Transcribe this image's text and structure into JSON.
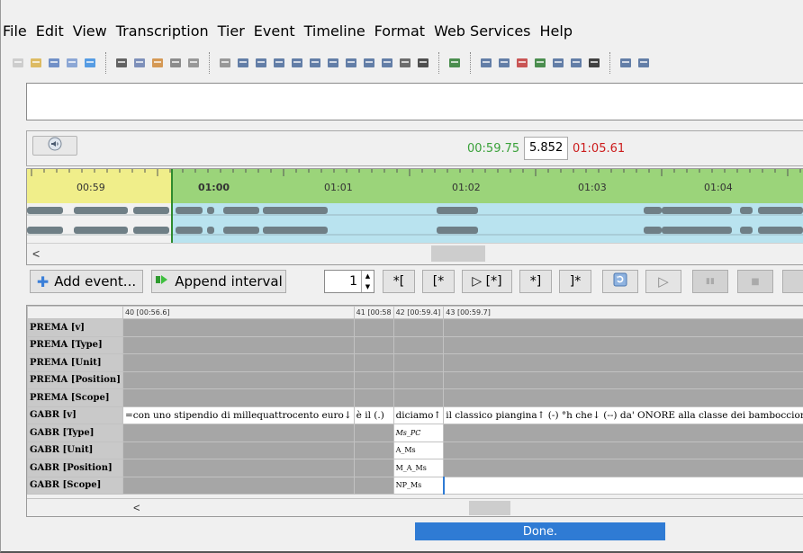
{
  "menu": [
    "File",
    "Edit",
    "View",
    "Transcription",
    "Tier",
    "Event",
    "Timeline",
    "Format",
    "Web Services",
    "Help"
  ],
  "toolbar_icons": [
    "new-file-icon",
    "open-folder-icon",
    "save-icon",
    "print-icon",
    "web-icon",
    "export-icon",
    "globe-icon",
    "people-icon",
    "search-icon",
    "split-text-icon",
    "merge-text-icon",
    "grid-a-icon",
    "grid-b-icon",
    "grid-c-icon",
    "move-left-icon",
    "move-right-icon",
    "insert-icon",
    "shift-right-icon",
    "shift-left-icon",
    "expand-icon",
    "cut-icon",
    "wave-icon",
    "tier-a-icon",
    "tier-b-icon",
    "tier-c-icon",
    "tier-d-icon",
    "tier-e-icon",
    "tier-f-icon",
    "tier-g-icon",
    "speaker-icon",
    "tier-h-icon",
    "tier-i-icon"
  ],
  "media": {
    "time_start": "00:59.75",
    "time_length": "5.852",
    "time_end": "01:05.61"
  },
  "timeline": {
    "ticks": [
      "00:59",
      "01:00",
      "01:01",
      "01:02",
      "01:03",
      "01:04"
    ]
  },
  "controls": {
    "add_event": "Add event...",
    "append_interval": "Append interval",
    "spinner_value": "1",
    "nav": [
      "*[",
      "[*",
      "▷ [*]",
      "*]",
      "]*"
    ]
  },
  "tiers": {
    "event_headers": [
      "40 [00:56.6]",
      "41 [00:58",
      "42 [00:59.4]",
      "43 [00:59.7]"
    ],
    "rows": [
      {
        "label": "PREMA [v]",
        "cells": [
          "",
          "",
          "",
          ""
        ]
      },
      {
        "label": "PREMA [Type]",
        "cells": [
          "",
          "",
          "",
          ""
        ]
      },
      {
        "label": "PREMA [Unit]",
        "cells": [
          "",
          "",
          "",
          ""
        ]
      },
      {
        "label": "PREMA [Position]",
        "cells": [
          "",
          "",
          "",
          ""
        ]
      },
      {
        "label": "PREMA [Scope]",
        "cells": [
          "",
          "",
          "",
          ""
        ]
      },
      {
        "label": "GABR [v]",
        "cells": [
          "=con uno stipendio di millequattrocento euro↓",
          "è il (.)",
          "diciamo↑",
          "il classico piangina↑ (-) °h che↓ (--) da' ONORE alla classe dei bamboccioni↓"
        ]
      },
      {
        "label": "GABR [Type]",
        "cells": [
          "",
          "",
          "Ms_PC",
          ""
        ]
      },
      {
        "label": "GABR [Unit]",
        "cells": [
          "",
          "",
          "A_Ms",
          ""
        ]
      },
      {
        "label": "GABR [Position]",
        "cells": [
          "",
          "",
          "M_A_Ms",
          ""
        ]
      },
      {
        "label": "GABR [Scope]",
        "cells": [
          "",
          "",
          "NP_Ms",
          ""
        ]
      }
    ]
  },
  "status": "Done."
}
